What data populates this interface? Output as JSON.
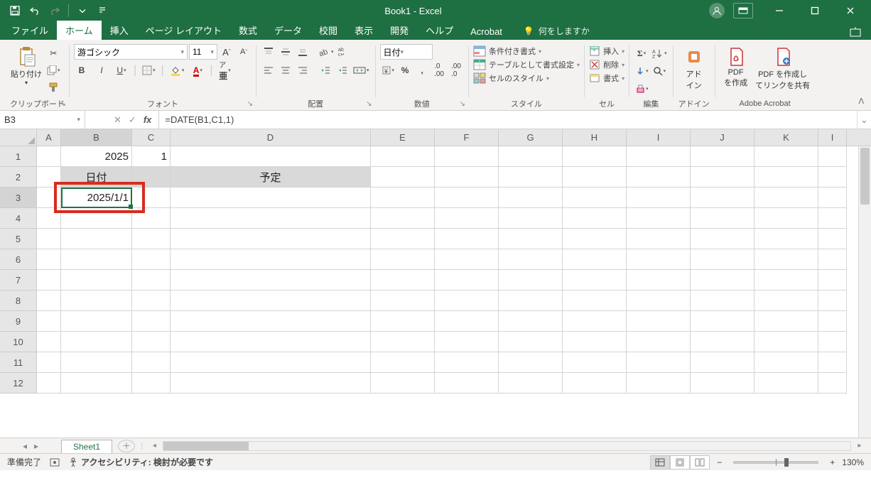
{
  "app": {
    "title": "Book1  -  Excel"
  },
  "tabs": {
    "file": "ファイル",
    "home": "ホーム",
    "insert": "挿入",
    "page": "ページ レイアウト",
    "formulas": "数式",
    "data": "データ",
    "review": "校閲",
    "view": "表示",
    "developer": "開発",
    "help": "ヘルプ",
    "acrobat": "Acrobat",
    "tellme": "何をしますか"
  },
  "ribbon": {
    "clipboard": {
      "paste": "貼り付け",
      "label": "クリップボード"
    },
    "font": {
      "name": "游ゴシック",
      "size": "11",
      "label": "フォント"
    },
    "align": {
      "label": "配置"
    },
    "number": {
      "format": "日付",
      "label": "数値"
    },
    "styles": {
      "cond": "条件付き書式",
      "table": "テーブルとして書式設定",
      "cell": "セルのスタイル",
      "label": "スタイル"
    },
    "cells": {
      "insert": "挿入",
      "delete": "削除",
      "format": "書式",
      "label": "セル"
    },
    "editing": {
      "label": "編集"
    },
    "addin": {
      "btn": "アド\nイン",
      "label": "アドイン"
    },
    "acrobat": {
      "create": "PDF\nを作成",
      "share": "PDF を作成し\nてリンクを共有",
      "label": "Adobe Acrobat"
    }
  },
  "formula": {
    "cell_ref": "B3",
    "text": "=DATE(B1,C1,1)"
  },
  "grid": {
    "cols": [
      "A",
      "B",
      "C",
      "D",
      "E",
      "F",
      "G",
      "H",
      "I",
      "J",
      "K",
      "I"
    ],
    "B1": "2025",
    "C1": "1",
    "B2": "日付",
    "D2": "予定",
    "B3": "2025/1/1"
  },
  "sheet": {
    "name": "Sheet1"
  },
  "status": {
    "ready": "準備完了",
    "acc": "アクセシビリティ: 検討が必要です",
    "zoom": "130%"
  }
}
